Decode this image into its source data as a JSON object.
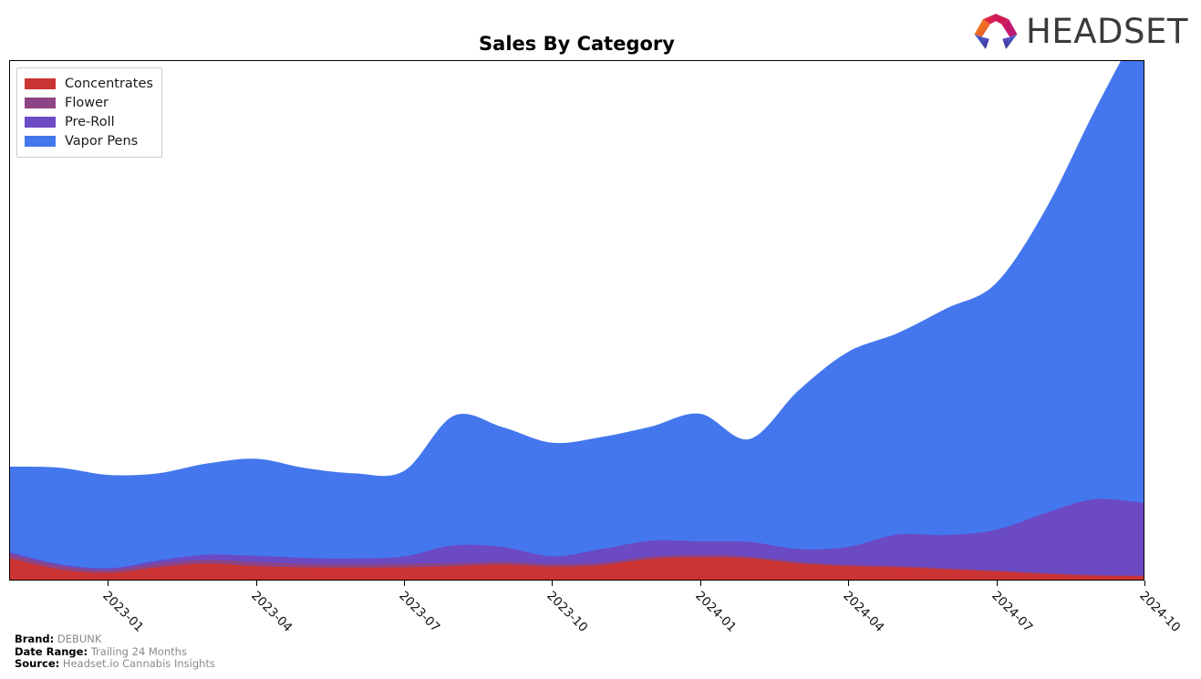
{
  "header": {
    "title": "Sales By Category",
    "logo_text": "HEADSET",
    "logo_icon": "headset-arch-logo"
  },
  "footer": {
    "brand_key": "Brand:",
    "brand_value": "DEBUNK",
    "date_range_key": "Date Range:",
    "date_range_value": "Trailing 24 Months",
    "source_key": "Source:",
    "source_value": "Headset.io Cannabis Insights"
  },
  "legend": {
    "position": "top-left",
    "items": [
      {
        "label": "Concentrates",
        "color": "#cc3333"
      },
      {
        "label": "Flower",
        "color": "#8e4585"
      },
      {
        "label": "Pre-Roll",
        "color": "#6b4ac4"
      },
      {
        "label": "Vapor Pens",
        "color": "#4477ee"
      }
    ]
  },
  "chart_data": {
    "type": "area",
    "stacked": true,
    "title": "Sales By Category",
    "xlabel": "",
    "ylabel": "",
    "grid": false,
    "legend_position": "upper left",
    "yaxis_labels_shown": false,
    "ylim": [
      0,
      100
    ],
    "x": [
      "2022-11",
      "2022-12",
      "2023-01",
      "2023-02",
      "2023-03",
      "2023-04",
      "2023-05",
      "2023-06",
      "2023-07",
      "2023-08",
      "2023-09",
      "2023-10",
      "2023-11",
      "2023-12",
      "2024-01",
      "2024-02",
      "2024-03",
      "2024-04",
      "2024-05",
      "2024-06",
      "2024-07",
      "2024-08",
      "2024-09",
      "2024-10"
    ],
    "xtick_labels": [
      "2023-01",
      "2023-04",
      "2023-07",
      "2023-10",
      "2024-01",
      "2024-04",
      "2024-07",
      "2024-10"
    ],
    "series": [
      {
        "name": "Concentrates",
        "color": "#cc3333",
        "values": [
          4.1,
          2.0,
          1.3,
          2.4,
          3.1,
          2.6,
          2.4,
          2.3,
          2.4,
          2.6,
          2.9,
          2.5,
          2.8,
          4.0,
          4.3,
          4.1,
          3.1,
          2.6,
          2.4,
          2.0,
          1.6,
          1.1,
          0.8,
          0.7
        ]
      },
      {
        "name": "Flower",
        "color": "#8e4585",
        "values": [
          0.8,
          0.7,
          0.6,
          0.7,
          0.7,
          0.8,
          0.7,
          0.7,
          0.7,
          0.6,
          0.6,
          0.6,
          0.5,
          0.5,
          0.5,
          0.4,
          0.4,
          0.3,
          0.3,
          0.2,
          0.2,
          0.2,
          0.1,
          0.1
        ]
      },
      {
        "name": "Pre-Roll",
        "color": "#6b4ac4",
        "values": [
          0.4,
          0.3,
          0.3,
          0.6,
          1.0,
          1.2,
          1.1,
          1.1,
          1.4,
          3.4,
          2.8,
          1.4,
          2.6,
          3.0,
          2.6,
          2.8,
          2.4,
          3.4,
          6.0,
          6.4,
          7.8,
          11.5,
          14.6,
          14.0
        ]
      },
      {
        "name": "Vapor Pens",
        "color": "#4477ee",
        "values": [
          16.5,
          18.6,
          18.0,
          16.8,
          17.6,
          18.7,
          17.3,
          16.4,
          16.5,
          25.0,
          23.1,
          21.9,
          21.6,
          22.0,
          24.6,
          19.8,
          30.6,
          37.6,
          38.8,
          43.7,
          47.5,
          58.4,
          74.8,
          93.5
        ]
      }
    ]
  }
}
